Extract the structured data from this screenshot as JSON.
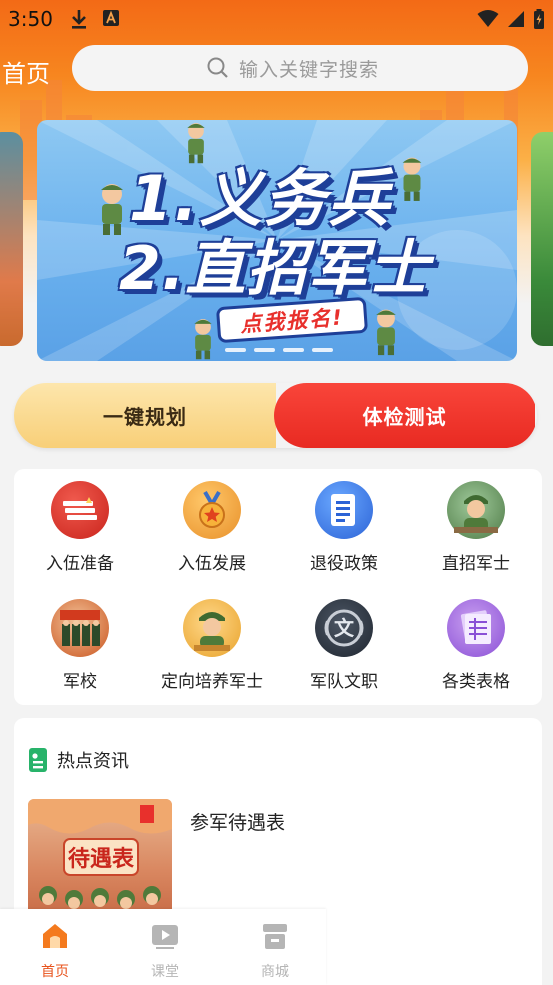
{
  "status_bar": {
    "time": "3:50"
  },
  "header": {
    "title": "首页",
    "search": {
      "placeholder": "输入关键字搜索"
    }
  },
  "banner": {
    "line1": "1.义务兵",
    "line2": "2.直招军士",
    "cta": "点我报名!"
  },
  "actions": {
    "plan_label": "一键规划",
    "exam_label": "体检测试"
  },
  "grid": {
    "items": [
      {
        "label": "入伍准备",
        "icon": "paper-stack-icon"
      },
      {
        "label": "入伍发展",
        "icon": "medal-icon"
      },
      {
        "label": "退役政策",
        "icon": "document-icon"
      },
      {
        "label": "直招军士",
        "icon": "soldier-avatar-icon"
      },
      {
        "label": "军校",
        "icon": "honor-guard-icon"
      },
      {
        "label": "定向培养军士",
        "icon": "officer-avatar-icon"
      },
      {
        "label": "军队文职",
        "icon": "wen-emblem-icon"
      },
      {
        "label": "各类表格",
        "icon": "forms-icon"
      }
    ]
  },
  "news": {
    "title": "热点资讯",
    "items": [
      {
        "title": "参军待遇表",
        "image_text": "待遇表"
      }
    ]
  },
  "tabbar": {
    "tabs": [
      {
        "label": "首页",
        "icon": "home-icon",
        "active": true
      },
      {
        "label": "课堂",
        "icon": "video-icon",
        "active": false
      },
      {
        "label": "商城",
        "icon": "store-icon",
        "active": false
      }
    ]
  },
  "colors": {
    "brand_orange": "#f36a16",
    "accent_red": "#e82a22",
    "active_tab": "#e8541e",
    "inactive_tab": "#b5b5b5"
  }
}
